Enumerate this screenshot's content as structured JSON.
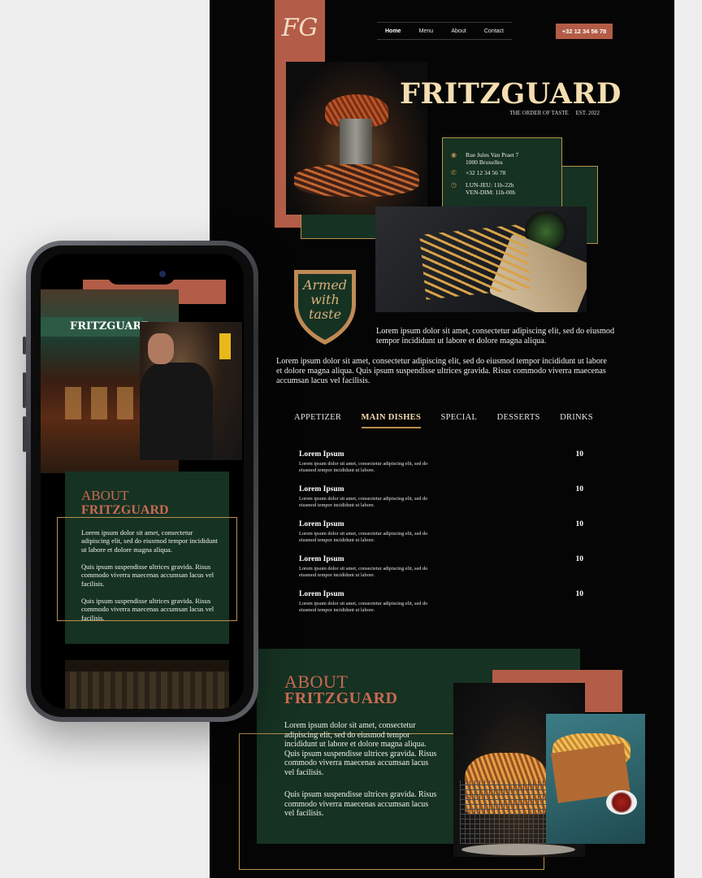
{
  "desktop": {
    "logo": "FG",
    "nav": [
      "Home",
      "Menu",
      "About",
      "Contact"
    ],
    "phone_button": "+32 12 34 56 78",
    "brand": "FRITZGUARD",
    "tagline": "THE ORDER OF TASTE     EST. 2022",
    "address": [
      "Rue Jules Van Praet 7",
      "1000 Bruxelles"
    ],
    "phone": "+32 12 34 56 78",
    "hours": [
      "LUN-JEU: 11h-22h",
      "VEN-DIM: 11h-00h"
    ],
    "shield": [
      "Armed",
      "with",
      "taste"
    ],
    "para1": "Lorem ipsum dolor sit amet, consectetur adipiscing elit, sed do eius­mod tempor incididunt ut labore et dolore magna aliqua.",
    "para2": "Lorem ipsum dolor sit amet, consectetur adipiscing elit, sed do eiusmod tempor incididunt ut labore et dolore magna aliqua. Quis ipsum suspendisse ultrices gravida. Risus commodo viverra maecenas accumsan lacus vel facilisis.",
    "tabs": [
      "APPETIZER",
      "MAIN DISHES",
      "SPECIAL",
      "DESSERTS",
      "DRINKS"
    ],
    "menu_items": [
      {
        "name": "Lorem Ipsum",
        "price": "10",
        "desc": "Lorem ipsum dolor sit amet, consectetur adipiscing elit, sed do eiusmod tempor incididunt ut labore."
      },
      {
        "name": "Lorem Ipsum",
        "price": "10",
        "desc": "Lorem ipsum dolor sit amet, consectetur adipiscing elit, sed do eiusmod tempor incididunt ut labore."
      },
      {
        "name": "Lorem Ipsum",
        "price": "10",
        "desc": "Lorem ipsum dolor sit amet, consectetur adipiscing elit, sed do eiusmod tempor incididunt ut labore."
      },
      {
        "name": "Lorem Ipsum",
        "price": "10",
        "desc": "Lorem ipsum dolor sit amet, consectetur adipiscing elit, sed do eiusmod tempor incididunt ut labore."
      },
      {
        "name": "Lorem Ipsum",
        "price": "10",
        "desc": "Lorem ipsum dolor sit amet, consectetur adipiscing elit, sed do eiusmod tempor incididunt ut labore."
      }
    ],
    "about_title_1": "ABOUT",
    "about_title_2": "FRITZGUARD",
    "about_p1": "Lorem ipsum dolor sit amet, consectetur adipiscing elit, sed do eiusmod tempor incididunt ut labore et dolore magna aliqua. Quis ipsum suspendisse ultrices gravida. Risus commodo viverra maecenas accumsan lacus vel facilisis.",
    "about_p2": "Quis ipsum suspendisse ultrices gravida. Risus commodo viverra maecenas accumsan lacus vel facilisis."
  },
  "mobile": {
    "storefront_sign": "FRITZGUARD",
    "about_title_1": "ABOUT",
    "about_title_2": "FRITZGUARD",
    "p1": "Lorem ipsum dolor sit amet, consectetur adipiscing elit, sed do eiusmod tempor incididunt ut labore et dolore magna aliqua.",
    "p2": "Quis ipsum suspendisse ultrices gravida. Risus commodo viverra maecenas accumsan lacus vel facilisis.",
    "p3": "Quis ipsum suspendisse ultrices gravida. Risus commodo viverra maecenas accumsan lacus vel facilisis."
  },
  "colors": {
    "rust": "#b35c47",
    "forest": "#163222",
    "gold": "#b8904f",
    "cream": "#f4ddb0"
  }
}
